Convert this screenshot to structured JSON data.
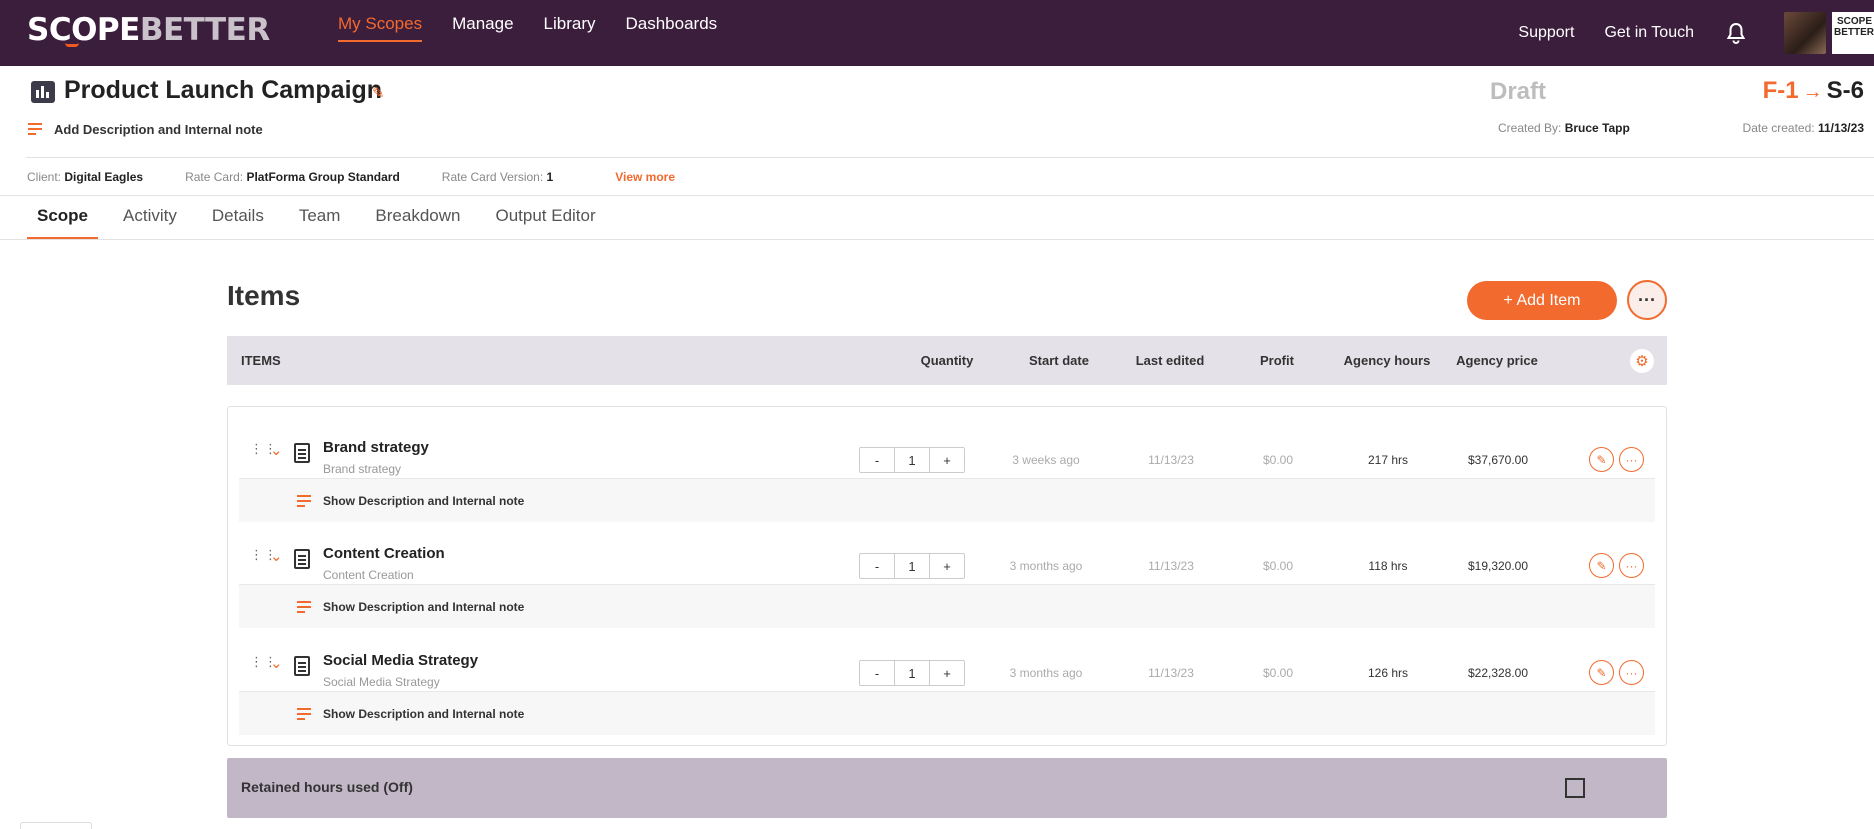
{
  "brand": {
    "logo_scope": "SCOPE",
    "logo_better": "BETTER",
    "mini_logo": "SCOPE BETTER"
  },
  "nav": {
    "items": [
      {
        "label": "My Scopes",
        "active": true
      },
      {
        "label": "Manage"
      },
      {
        "label": "Library"
      },
      {
        "label": "Dashboards"
      }
    ],
    "support": "Support",
    "get_in_touch": "Get in Touch"
  },
  "scope": {
    "title": "Product Launch Campaign",
    "add_description": "Add Description and Internal note",
    "status": "Draft",
    "version_from": "F-1",
    "version_arrow": "→",
    "version_to": "S-6",
    "created_by_label": "Created By:",
    "created_by": "Bruce Tapp",
    "date_created_label": "Date created:",
    "date_created": "11/13/23"
  },
  "meta": {
    "client_label": "Client:",
    "client": "Digital Eagles",
    "rate_card_label": "Rate Card:",
    "rate_card": "PlatForma Group Standard",
    "rate_card_version_label": "Rate Card Version:",
    "rate_card_version": "1",
    "view_more": "View more"
  },
  "tabs": [
    {
      "label": "Scope",
      "active": true
    },
    {
      "label": "Activity"
    },
    {
      "label": "Details"
    },
    {
      "label": "Team"
    },
    {
      "label": "Breakdown"
    },
    {
      "label": "Output Editor"
    }
  ],
  "items_section": {
    "title": "Items",
    "add_item": "+ Add Item",
    "more": "···"
  },
  "table": {
    "headers": {
      "items": "ITEMS",
      "quantity": "Quantity",
      "start_date": "Start date",
      "last_edited": "Last edited",
      "profit": "Profit",
      "agency_hours": "Agency hours",
      "agency_price": "Agency price"
    },
    "rows": [
      {
        "title": "Brand strategy",
        "subtitle": "Brand strategy",
        "minus": "-",
        "qty": "1",
        "plus": "+",
        "start_date": "3 weeks ago",
        "last_edited": "11/13/23",
        "profit": "$0.00",
        "hours": "217 hrs",
        "price": "$37,670.00",
        "desc": "Show Description and Internal note"
      },
      {
        "title": "Content Creation",
        "subtitle": "Content Creation",
        "minus": "-",
        "qty": "1",
        "plus": "+",
        "start_date": "3 months ago",
        "last_edited": "11/13/23",
        "profit": "$0.00",
        "hours": "118 hrs",
        "price": "$19,320.00",
        "desc": "Show Description and Internal note"
      },
      {
        "title": "Social Media Strategy",
        "subtitle": "Social Media Strategy",
        "minus": "-",
        "qty": "1",
        "plus": "+",
        "start_date": "3 months ago",
        "last_edited": "11/13/23",
        "profit": "$0.00",
        "hours": "126 hrs",
        "price": "$22,328.00",
        "desc": "Show Description and Internal note"
      }
    ]
  },
  "retained": {
    "label": "Retained hours used (Off)",
    "checked": false
  },
  "colors": {
    "nav_bg": "#3b1d3c",
    "accent": "#f26a2e",
    "header_row": "#e5e1e8",
    "retained_bg": "#c2b7c7"
  }
}
